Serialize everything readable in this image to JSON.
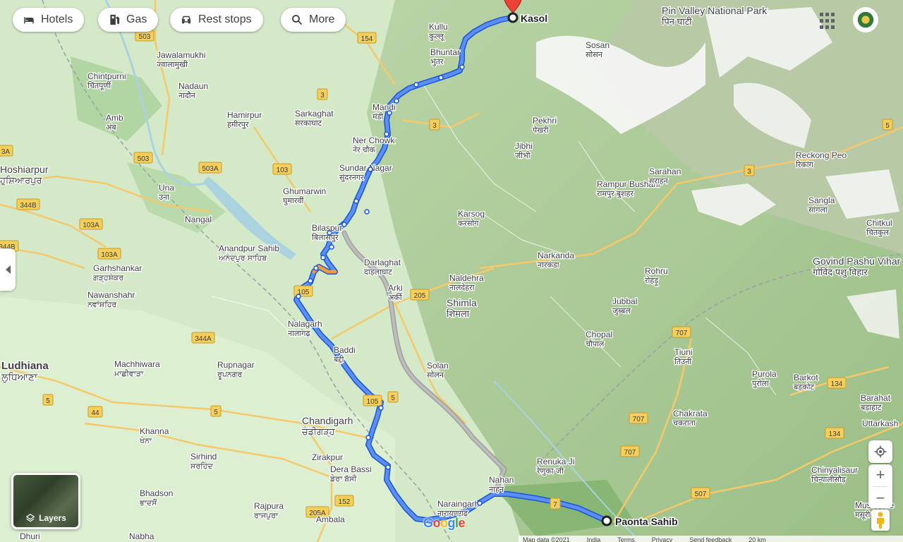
{
  "toolbar": {
    "hotels": "Hotels",
    "gas": "Gas",
    "rest_stops": "Rest stops",
    "more": "More"
  },
  "route": {
    "origin": "Paonta Sahib",
    "destination": "Kasol"
  },
  "places": [
    {
      "en": "Kullu",
      "local": "कुल्लू"
    },
    {
      "en": "Bhuntar",
      "local": "भुंतर"
    },
    {
      "en": "Jawalamukhi",
      "local": "ज्वालामुखी"
    },
    {
      "en": "Chintpurni",
      "local": "चिंतपूर्णी"
    },
    {
      "en": "Nadaun",
      "local": "नादौन"
    },
    {
      "en": "Hamirpur",
      "local": "हमीरपुर"
    },
    {
      "en": "Sarkaghat",
      "local": "सरकाघाट"
    },
    {
      "en": "Mandi",
      "local": "मंडी"
    },
    {
      "en": "Amb",
      "local": "अंब"
    },
    {
      "en": "Ner Chowk",
      "local": "नेर चौक"
    },
    {
      "en": "Sundar Nagar",
      "local": "सुंदरनगर"
    },
    {
      "en": "Hoshiarpur",
      "local": "ਹੁਸ਼ਿਆਰਪੁਰ"
    },
    {
      "en": "Una",
      "local": "उना"
    },
    {
      "en": "Ghumarwin",
      "local": "घुमारवीं"
    },
    {
      "en": "Nangal",
      "local": ""
    },
    {
      "en": "Bilaspur",
      "local": "बिलासपुर"
    },
    {
      "en": "Karsog",
      "local": "करसोग"
    },
    {
      "en": "Anandpur Sahib",
      "local": "ਅਨੰਦਪੁਰ ਸਾਹਿਬ"
    },
    {
      "en": "Darlaghat",
      "local": "दाड़लाघाट"
    },
    {
      "en": "Garhshankar",
      "local": "ਗੜ੍ਹਸ਼ੰਕਰ"
    },
    {
      "en": "Nawanshahr",
      "local": "ਨਵਾਂਸ਼ਹਿਰ"
    },
    {
      "en": "Naldehra",
      "local": "नालदेहरा"
    },
    {
      "en": "Arki",
      "local": "अर्की"
    },
    {
      "en": "Shimla",
      "local": "शिमला"
    },
    {
      "en": "Nalagarh",
      "local": "नालागढ़"
    },
    {
      "en": "Baddi",
      "local": "बद्दी"
    },
    {
      "en": "Rupnagar",
      "local": "ਰੂਪਨਗਰ"
    },
    {
      "en": "Machhiwara",
      "local": "ਮਾਛੀਵਾੜਾ"
    },
    {
      "en": "Ludhiana",
      "local": "ਲੁਧਿਆਣਾ"
    },
    {
      "en": "Solan",
      "local": "सोलन"
    },
    {
      "en": "Chandigarh",
      "local": "ਚੰਡੀਗੜ੍ਹ"
    },
    {
      "en": "Khanna",
      "local": "ਖੰਨਾ"
    },
    {
      "en": "Sirhind",
      "local": "ਸਰਹਿੰਦ"
    },
    {
      "en": "Zirakpur",
      "local": ""
    },
    {
      "en": "Dera Bassi",
      "local": "ਡੇਰਾ ਬੱਸੀ"
    },
    {
      "en": "Bhadson",
      "local": "ਭਾਦਸੋਂ"
    },
    {
      "en": "Rajpura",
      "local": "ਰਾਜਪੁਰਾ"
    },
    {
      "en": "Ambala",
      "local": ""
    },
    {
      "en": "Nahan",
      "local": "नाहन"
    },
    {
      "en": "Naraingarh",
      "local": "नारायणगढ़"
    },
    {
      "en": "Renuka Ji",
      "local": "रेणुका जी"
    },
    {
      "en": "Sosan",
      "local": "सोसन"
    },
    {
      "en": "Pekhri",
      "local": "पेखरी"
    },
    {
      "en": "Jibhi",
      "local": "जीभी"
    },
    {
      "en": "Rampur Bushahr",
      "local": "रामपुर बुशहर"
    },
    {
      "en": "Sarahan",
      "local": "सराहन"
    },
    {
      "en": "Narkanda",
      "local": "नारकंडा"
    },
    {
      "en": "Rohru",
      "local": "रोहड़ू"
    },
    {
      "en": "Jubbal",
      "local": "जुब्बल"
    },
    {
      "en": "Chopal",
      "local": "चौपाल"
    },
    {
      "en": "Tiuni",
      "local": "तिउनी"
    },
    {
      "en": "Chakrata",
      "local": "चकराता"
    },
    {
      "en": "Purola",
      "local": "पुरोला"
    },
    {
      "en": "Barkot",
      "local": "बड़कोट"
    },
    {
      "en": "Reckong Peo",
      "local": "रिकांग"
    },
    {
      "en": "Sangla",
      "local": "सांगला"
    },
    {
      "en": "Chitkul",
      "local": "चितकुल"
    },
    {
      "en": "Govind Pashu Vihar National Park & Sanctuary",
      "local": "गोविंद पशु विहार"
    },
    {
      "en": "Chinyalisaur",
      "local": "चिन्यालीसौड़"
    },
    {
      "en": "Mussoorie",
      "local": "मसूरी"
    },
    {
      "en": "Barahat",
      "local": "बड़ाहाट"
    },
    {
      "en": "Uttarkash",
      "local": ""
    },
    {
      "en": "Pin Valley National Park",
      "local": "पिन घाटी"
    },
    {
      "en": "Dhuri",
      "local": ""
    },
    {
      "en": "Nabha",
      "local": ""
    }
  ],
  "roads": [
    "503",
    "154",
    "3",
    "3",
    "503",
    "503A",
    "103",
    "3",
    "344B",
    "103A",
    "344B",
    "103A",
    "105",
    "205",
    "344A",
    "5",
    "44",
    "5",
    "105",
    "5",
    "152",
    "205A",
    "7",
    "707",
    "707",
    "707",
    "507",
    "5",
    "134",
    "134",
    "3A"
  ],
  "controls": {
    "layers_label": "Layers",
    "zoom_in": "+",
    "zoom_out": "−"
  },
  "footer": {
    "map_data": "Map data ©2021",
    "region": "India",
    "terms": "Terms",
    "privacy": "Privacy",
    "feedback": "Send feedback",
    "scale": "20 km"
  },
  "colors": {
    "route_primary": "#4a80f0",
    "route_alt": "#9e9e9e",
    "highway": "#f5c96a",
    "land": "#cfe6c3",
    "snow": "#f4f5f3",
    "mountain": "#9cbf88",
    "water": "#aad3df",
    "destination_pin": "#ea4335"
  }
}
